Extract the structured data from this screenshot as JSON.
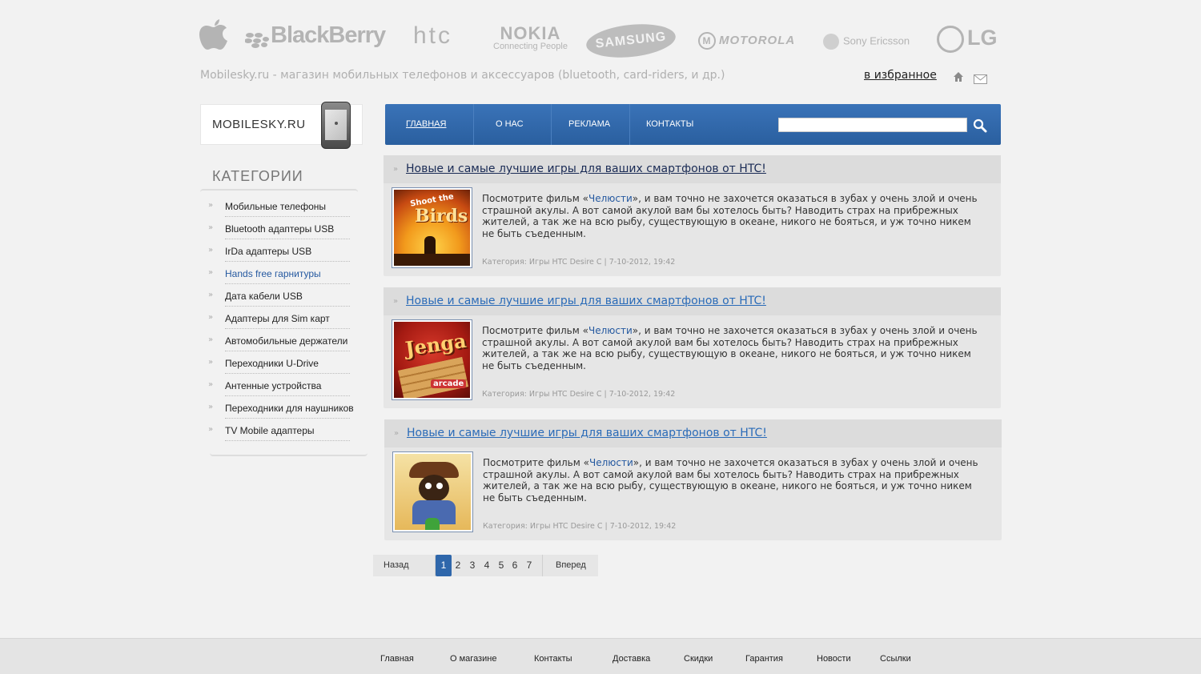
{
  "brands": {
    "blackberry": "BlackBerry",
    "htc": "htc",
    "nokia": "NOKIA",
    "nokia_sub": "Connecting People",
    "samsung": "SAMSUNG",
    "motorola": "MOTOROLA",
    "sony": "Sony Ericsson",
    "lg": "LG"
  },
  "header": {
    "tagline": "Mobilesky.ru - магазин мобильных телефонов и аксессуаров (bluetooth, card-riders, и др.)",
    "favorite_link": "в избранное"
  },
  "logo": {
    "text": "MOBILESKY.RU"
  },
  "sidebar": {
    "title": "КАТЕГОРИИ",
    "items": [
      {
        "label": "Мобильные телефоны"
      },
      {
        "label": "Bluetooth адаптеры USB"
      },
      {
        "label": "IrDa адаптеры USB"
      },
      {
        "label": "Hands free гарнитуры"
      },
      {
        "label": "Дата кабели USB"
      },
      {
        "label": "Адаптеры для Sim карт"
      },
      {
        "label": "Автомобильные держатели"
      },
      {
        "label": "Переходники U-Drive"
      },
      {
        "label": "Антенные устройства"
      },
      {
        "label": "Переходники для наушников"
      },
      {
        "label": "TV Mobile адаптеры"
      }
    ]
  },
  "nav": {
    "items": [
      {
        "label": "ГЛАВНАЯ"
      },
      {
        "label": "О НАС"
      },
      {
        "label": "РЕКЛАМА"
      },
      {
        "label": "КОНТАКТЫ"
      }
    ],
    "search_placeholder": ""
  },
  "articles": [
    {
      "title": "Новые и самые лучшие игры для ваших смартфонов от HTC!",
      "text_before": "Посмотрите фильм «",
      "highlight": "Челюсти",
      "text_after": "», и вам точно не захочется оказаться в зубах у очень злой и очень страшной акулы. А вот самой акулой вам бы хотелось быть? Наводить страх на прибрежных жителей, а так же на всю рыбу, существующую в океане, никого не бояться, и уж точно никем не быть съеденным.",
      "meta": "Категория: Игры HTC Desire C | 7-10-2012, 19:42",
      "thumb_line1": "Shoot the",
      "thumb_line2": "Birds"
    },
    {
      "title": "Новые и самые лучшие игры для ваших смартфонов от HTC!",
      "text_before": "Посмотрите фильм «",
      "highlight": "Челюсти",
      "text_after": "», и вам точно не захочется оказаться в зубах у очень злой и очень страшной акулы. А вот самой акулой вам бы хотелось быть? Наводить страх на прибрежных жителей, а так же на всю рыбу, существующую в океане, никого не бояться, и уж точно никем не быть съеденным.",
      "meta": "Категория: Игры HTC Desire C | 7-10-2012, 19:42",
      "thumb_line1": "Jenga",
      "thumb_line2": "arcade"
    },
    {
      "title": "Новые и самые лучшие игры для ваших смартфонов от HTC!",
      "text_before": "Посмотрите фильм «",
      "highlight": "Челюсти",
      "text_after": "», и вам точно не захочется оказаться в зубах у очень злой и очень страшной акулы. А вот самой акулой вам бы хотелось быть? Наводить страх на прибрежных жителей, а так же на всю рыбу, существующую в океане, никого не бояться, и уж точно никем не быть съеденным.",
      "meta": "Категория: Игры HTC Desire C | 7-10-2012, 19:42"
    }
  ],
  "pager": {
    "prev": "Назад",
    "next": "Вперед",
    "pages": [
      "1",
      "2",
      "3",
      "4",
      "5",
      "6",
      "7"
    ],
    "current": "1"
  },
  "footer": {
    "links": [
      {
        "label": "Главная"
      },
      {
        "label": "О магазине"
      },
      {
        "label": "Контакты"
      },
      {
        "label": "Доставка"
      },
      {
        "label": "Скидки"
      },
      {
        "label": "Гарантия"
      },
      {
        "label": "Новости"
      },
      {
        "label": "Ссылки"
      }
    ]
  },
  "colors": {
    "nav_blue": "#2f67ab",
    "link_blue": "#2a6bb8",
    "page_bg": "#f2f2f2"
  }
}
